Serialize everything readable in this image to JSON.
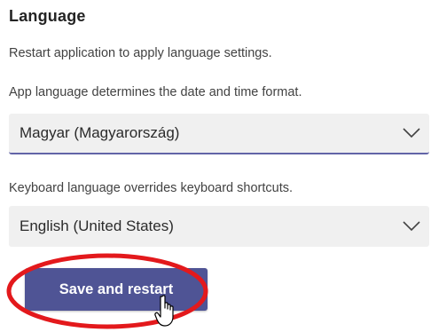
{
  "section": {
    "title": "Language",
    "restart_hint": "Restart application to apply language settings."
  },
  "app_language": {
    "description": "App language determines the date and time format.",
    "selected": "Magyar (Magyarország)"
  },
  "keyboard_language": {
    "description": "Keyboard language overrides keyboard shortcuts.",
    "selected": "English (United States)"
  },
  "actions": {
    "save_label": "Save and restart"
  },
  "colors": {
    "accent": "#6264a7",
    "button": "#4f5495",
    "annotation": "#e3191c",
    "dropdown_bg": "#f0f0f0"
  },
  "icons": {
    "dropdown": "chevron-down-icon",
    "cursor": "hand-pointer-icon"
  }
}
